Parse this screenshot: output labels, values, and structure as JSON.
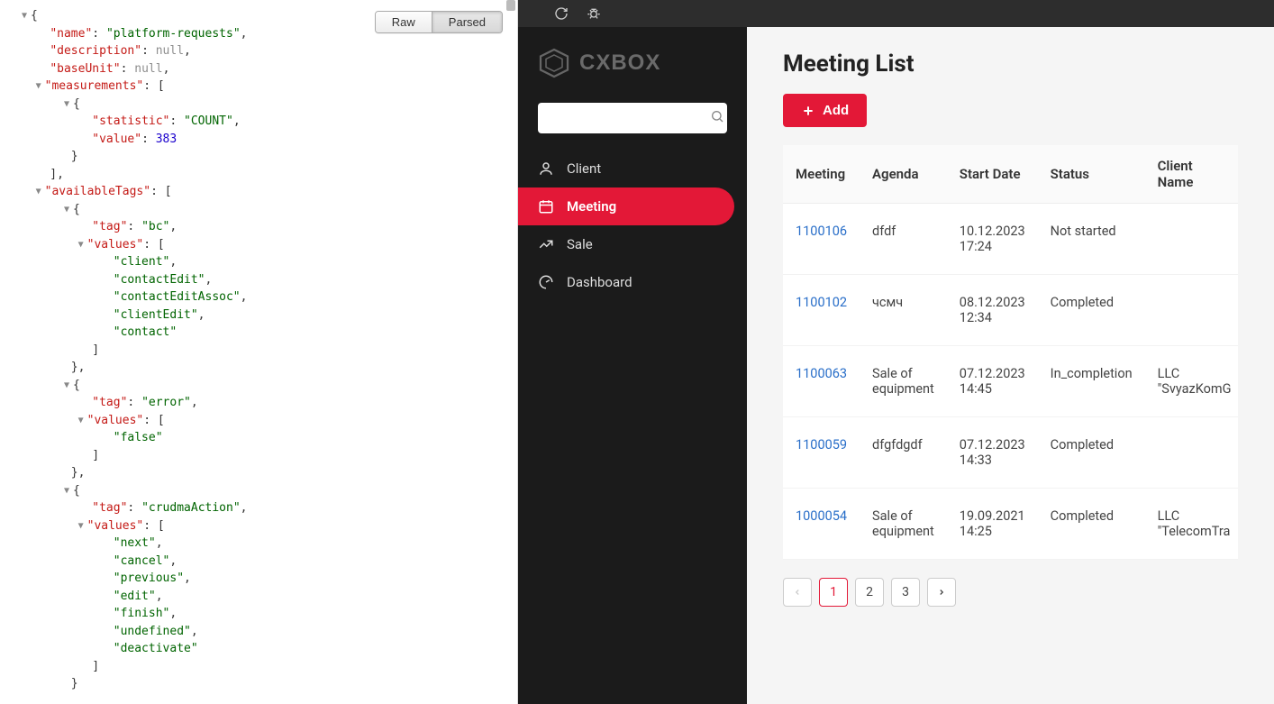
{
  "json_viewer": {
    "buttons": {
      "raw": "Raw",
      "parsed": "Parsed"
    },
    "root": {
      "name_key": "\"name\"",
      "name_val": "\"platform-requests\"",
      "description_key": "\"description\"",
      "description_val": "null",
      "baseUnit_key": "\"baseUnit\"",
      "baseUnit_val": "null",
      "measurements_key": "\"measurements\"",
      "stat_key": "\"statistic\"",
      "stat_val": "\"COUNT\"",
      "value_key": "\"value\"",
      "value_val": "383",
      "availableTags_key": "\"availableTags\"",
      "tag_key": "\"tag\"",
      "values_key": "\"values\"",
      "tag1_val": "\"bc\"",
      "tag1_values": [
        "\"client\"",
        "\"contactEdit\"",
        "\"contactEditAssoc\"",
        "\"clientEdit\"",
        "\"contact\""
      ],
      "tag2_val": "\"error\"",
      "tag2_values": [
        "\"false\""
      ],
      "tag3_val": "\"crudmaAction\"",
      "tag3_values": [
        "\"next\"",
        "\"cancel\"",
        "\"previous\"",
        "\"edit\"",
        "\"finish\"",
        "\"undefined\"",
        "\"deactivate\""
      ]
    }
  },
  "app": {
    "brand": "CXBOX",
    "search_placeholder": "",
    "nav": [
      {
        "label": "Client"
      },
      {
        "label": "Meeting"
      },
      {
        "label": "Sale"
      },
      {
        "label": "Dashboard"
      }
    ],
    "page_title": "Meeting List",
    "add_button": "Add",
    "columns": [
      "Meeting",
      "Agenda",
      "Start Date",
      "Status",
      "Client Name"
    ],
    "rows": [
      {
        "meeting": "1100106",
        "agenda": "dfdf",
        "start": "10.12.2023 17:24",
        "status": "Not started",
        "client": ""
      },
      {
        "meeting": "1100102",
        "agenda": "чсмч",
        "start": "08.12.2023 12:34",
        "status": "Completed",
        "client": ""
      },
      {
        "meeting": "1100063",
        "agenda": "Sale of equipment",
        "start": "07.12.2023 14:45",
        "status": "In_completion",
        "client": "LLC \"SvyazKomG"
      },
      {
        "meeting": "1100059",
        "agenda": "dfgfdgdf",
        "start": "07.12.2023 14:33",
        "status": "Completed",
        "client": ""
      },
      {
        "meeting": "1000054",
        "agenda": "Sale of equipment",
        "start": "19.09.2021 14:25",
        "status": "Completed",
        "client": "LLC \"TelecomTra"
      }
    ],
    "pagination": {
      "pages": [
        "1",
        "2",
        "3"
      ],
      "current": 0
    }
  }
}
